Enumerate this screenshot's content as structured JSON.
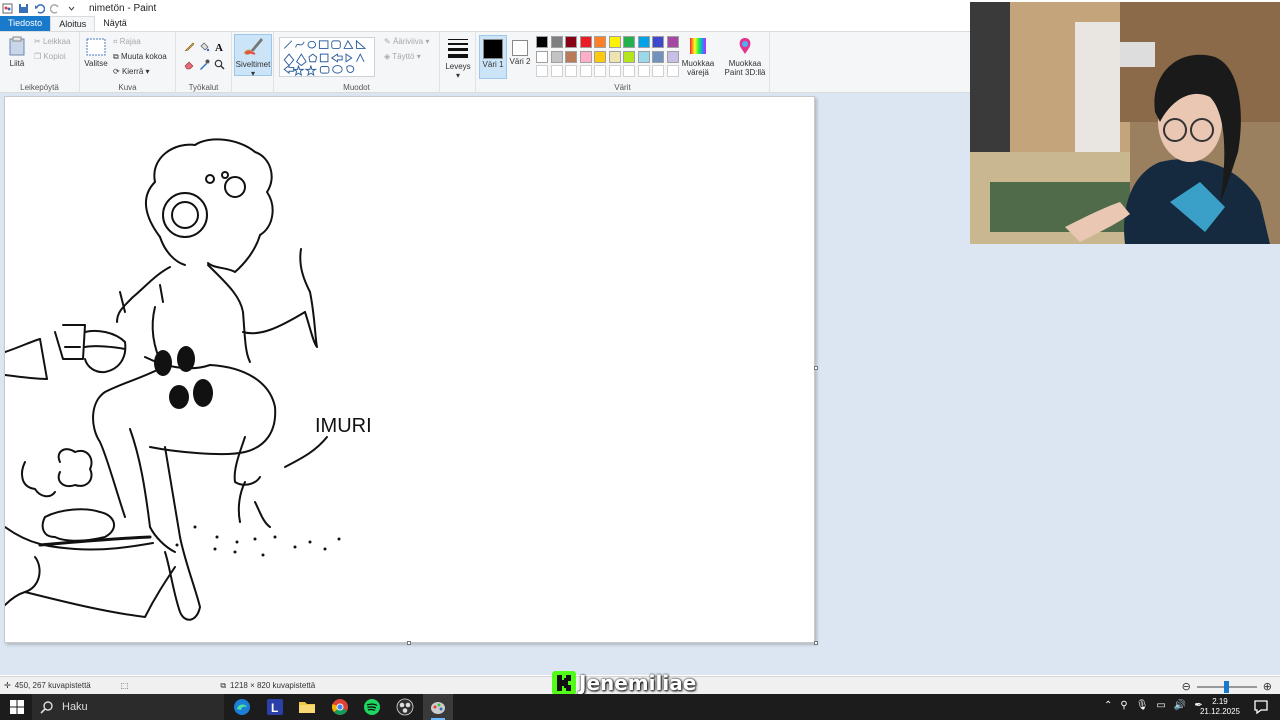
{
  "window": {
    "title": "nimetön - Paint"
  },
  "tabs": [
    {
      "label": "Tiedosto"
    },
    {
      "label": "Aloitus"
    },
    {
      "label": "Näytä"
    }
  ],
  "ribbon": {
    "clipboard": {
      "paste": "Liitä",
      "cut": "Leikkaa",
      "copy": "Kopioi",
      "label": "Leikepöytä"
    },
    "image": {
      "select": "Valitse",
      "crop": "Rajaa",
      "resize": "Muuta kokoa",
      "rotate": "Kierrä",
      "label": "Kuva"
    },
    "tools": {
      "label": "Työkalut"
    },
    "brushes": {
      "label": "Siveltimet"
    },
    "shapes": {
      "outline": "Ääriviiva",
      "fill": "Täyttö",
      "label": "Muodot"
    },
    "size": {
      "label": "Leveys"
    },
    "colors": {
      "color1": "Väri 1",
      "color2": "Väri 2",
      "edit_colors": "Muokkaa värejä",
      "edit_paint3d": "Muokkaa Paint 3D:llä",
      "label": "Värit",
      "active_color": "#000000",
      "palette_row1": [
        "#000000",
        "#7f7f7f",
        "#880015",
        "#ed1c24",
        "#ff7f27",
        "#fff200",
        "#22b14c",
        "#00a2e8",
        "#3f48cc",
        "#a349a4"
      ],
      "palette_row2": [
        "#ffffff",
        "#c3c3c3",
        "#b97a57",
        "#ffaec9",
        "#ffc90e",
        "#efe4b0",
        "#b5e61d",
        "#99d9ea",
        "#7092be",
        "#c8bfe7"
      ]
    }
  },
  "canvas": {
    "drawn_text": "IMURI"
  },
  "status": {
    "cursor_pos": "450, 267 kuvapistettä",
    "image_size": "1218 × 820 kuvapistettä"
  },
  "watermark": {
    "text": "Jenemiliae",
    "accent": "#53fc18"
  },
  "taskbar": {
    "search_label": "Haku",
    "time": "2.19",
    "date": "21.12.2025"
  }
}
